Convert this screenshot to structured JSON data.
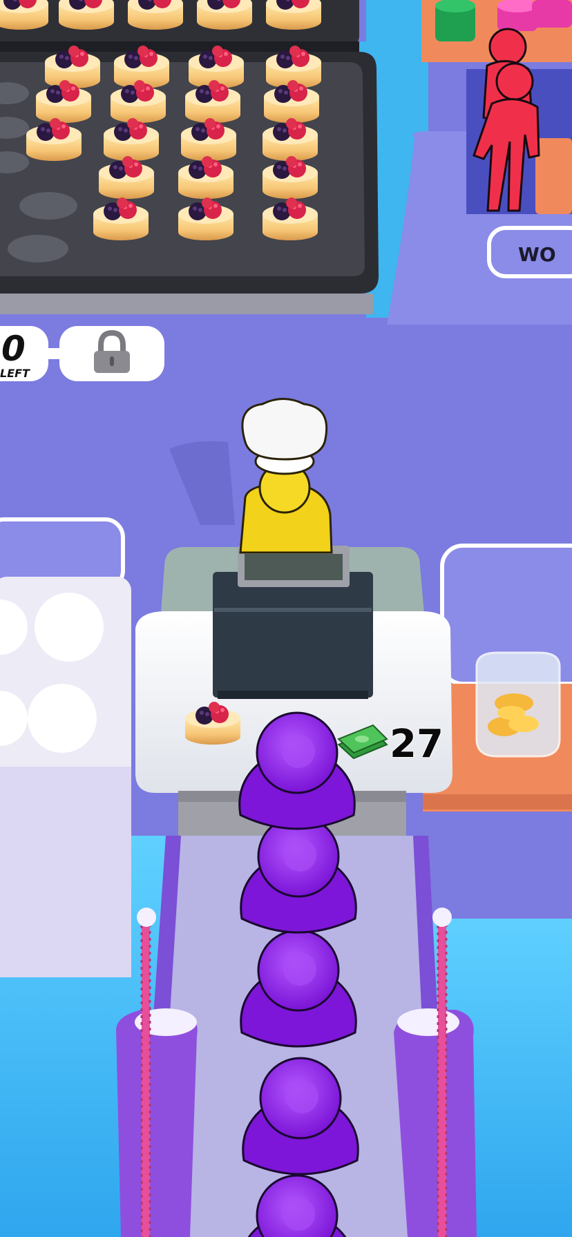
{
  "hud": {
    "left_counter_value": "0",
    "left_counter_caption": "LEFT",
    "lock_icon": "lock-icon",
    "right_sign_text": "WO",
    "money_icon": "cash-stack-icon",
    "money_amount": "27"
  },
  "colors": {
    "floor": "#7b7be0",
    "water": "#45b8f2",
    "customers": "#8a1fe0",
    "red_characters": "#f0304a",
    "chef": "#f2d21a",
    "tray": "#3a3b42",
    "rope": "#e84f9a"
  },
  "scene": {
    "cheesecake_count_tray": 20,
    "queue_customers": 5
  }
}
